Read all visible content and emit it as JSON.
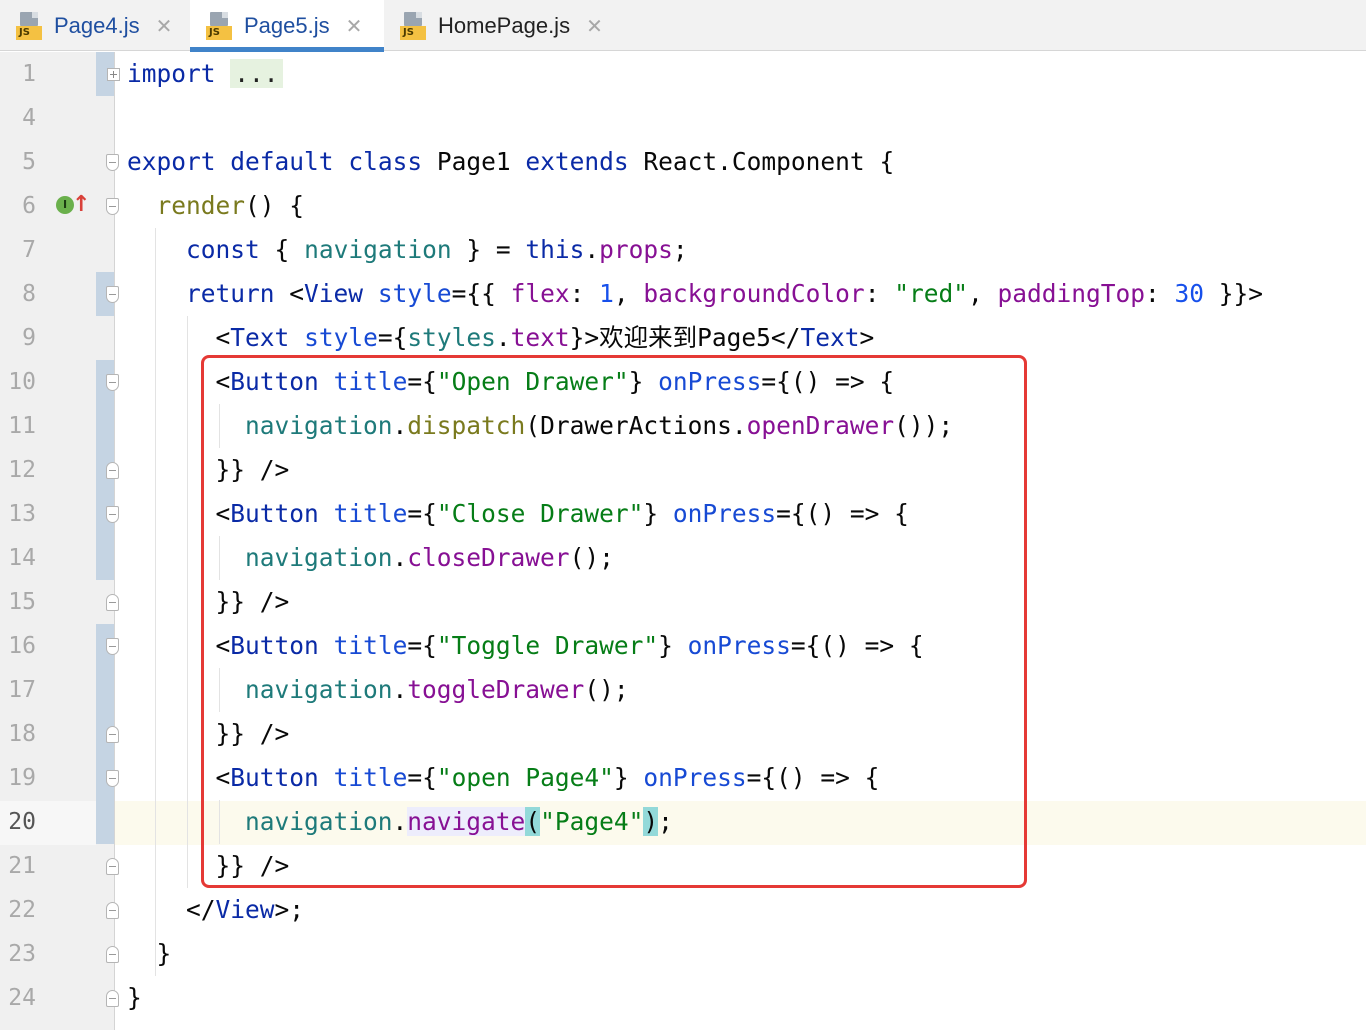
{
  "tabs": [
    {
      "label": "Page4.js",
      "icon": "js-file-icon",
      "active": false
    },
    {
      "label": "Page5.js",
      "icon": "js-file-icon",
      "active": true
    },
    {
      "label": "HomePage.js",
      "icon": "js-file-icon",
      "active": false
    }
  ],
  "file_icon_badge": "JS",
  "close_glyph": "✕",
  "gutter": {
    "line_numbers": [
      "1",
      "4",
      "5",
      "6",
      "7",
      "8",
      "9",
      "10",
      "11",
      "12",
      "13",
      "14",
      "15",
      "16",
      "17",
      "18",
      "19",
      "20",
      "21",
      "22",
      "23",
      "24"
    ],
    "current_line": "20",
    "implements_icon": "I",
    "implements_arrow": "↑"
  },
  "code": {
    "l1": {
      "kw": "import",
      "folded": "..."
    },
    "l5": {
      "kw1": "export",
      "kw2": "default",
      "kw3": "class",
      "name": "Page1",
      "kw4": "extends",
      "parent": "React.Component",
      "open": "{"
    },
    "l6": {
      "fn": "render",
      "rest": "() {"
    },
    "l7": {
      "kw": "const",
      "p1": "{ ",
      "param": "navigation",
      "p2": " } = ",
      "kw2": "this",
      "dot": ".",
      "prop": "props",
      "end": ";"
    },
    "l8": {
      "kw": "return",
      "lt": " <",
      "tag": "View",
      "attr": "style",
      "eq": "={{ ",
      "prop1": "flex",
      "c1": ": ",
      "num1": "1",
      "sep1": ", ",
      "prop2": "backgroundColor",
      "c2": ": ",
      "str": "\"red\"",
      "sep2": ", ",
      "prop3": "paddingTop",
      "c3": ": ",
      "num2": "30",
      "end": " }}>"
    },
    "l9": {
      "lt": "<",
      "tag": "Text",
      "attr": "style",
      "eq": "={",
      "obj": "styles",
      "dot": ".",
      "prop": "text",
      "mid": "}>",
      "text": "欢迎来到Page5",
      "close_lt": "</",
      "close_tag": "Text",
      "gt": ">"
    },
    "l10": {
      "lt": "<",
      "tag": "Button",
      "attr": "title",
      "eq": "={",
      "str": "\"Open Drawer\"",
      "mid": "} ",
      "attr2": "onPress",
      "eq2": "={",
      "rest": "() => {"
    },
    "l11": {
      "param": "navigation",
      "dot": ".",
      "fn": "dispatch",
      "p1": "(DrawerActions.",
      "prop": "openDrawer",
      "end": "());"
    },
    "l12": {
      "text": "}} />"
    },
    "l13": {
      "lt": "<",
      "tag": "Button",
      "attr": "title",
      "eq": "={",
      "str": "\"Close Drawer\"",
      "mid": "} ",
      "attr2": "onPress",
      "eq2": "={",
      "rest": "() => {"
    },
    "l14": {
      "param": "navigation",
      "dot": ".",
      "fn": "closeDrawer",
      "end": "();"
    },
    "l15": {
      "text": "}} />"
    },
    "l16": {
      "lt": "<",
      "tag": "Button",
      "attr": "title",
      "eq": "={",
      "str": "\"Toggle Drawer\"",
      "mid": "} ",
      "attr2": "onPress",
      "eq2": "={",
      "rest": "() => {"
    },
    "l17": {
      "param": "navigation",
      "dot": ".",
      "fn": "toggleDrawer",
      "end": "();"
    },
    "l18": {
      "text": "}} />"
    },
    "l19": {
      "lt": "<",
      "tag": "Button",
      "attr": "title",
      "eq": "={",
      "str": "\"open Page4\"",
      "mid": "} ",
      "attr2": "onPress",
      "eq2": "={",
      "rest": "() => {"
    },
    "l20": {
      "param": "navigation",
      "dot": ".",
      "fn": "navigate",
      "open": "(",
      "str": "\"Page4\"",
      "close": ")",
      "end": ";"
    },
    "l21": {
      "text": "}} />"
    },
    "l22": {
      "lt": "</",
      "tag": "View",
      "end": ">;"
    },
    "l23": {
      "text": "}"
    },
    "l24": {
      "text": "}"
    }
  },
  "colors": {
    "highlight_box": "#e53935",
    "keyword": "#0a2aa6",
    "string": "#067d17",
    "property": "#871094"
  }
}
